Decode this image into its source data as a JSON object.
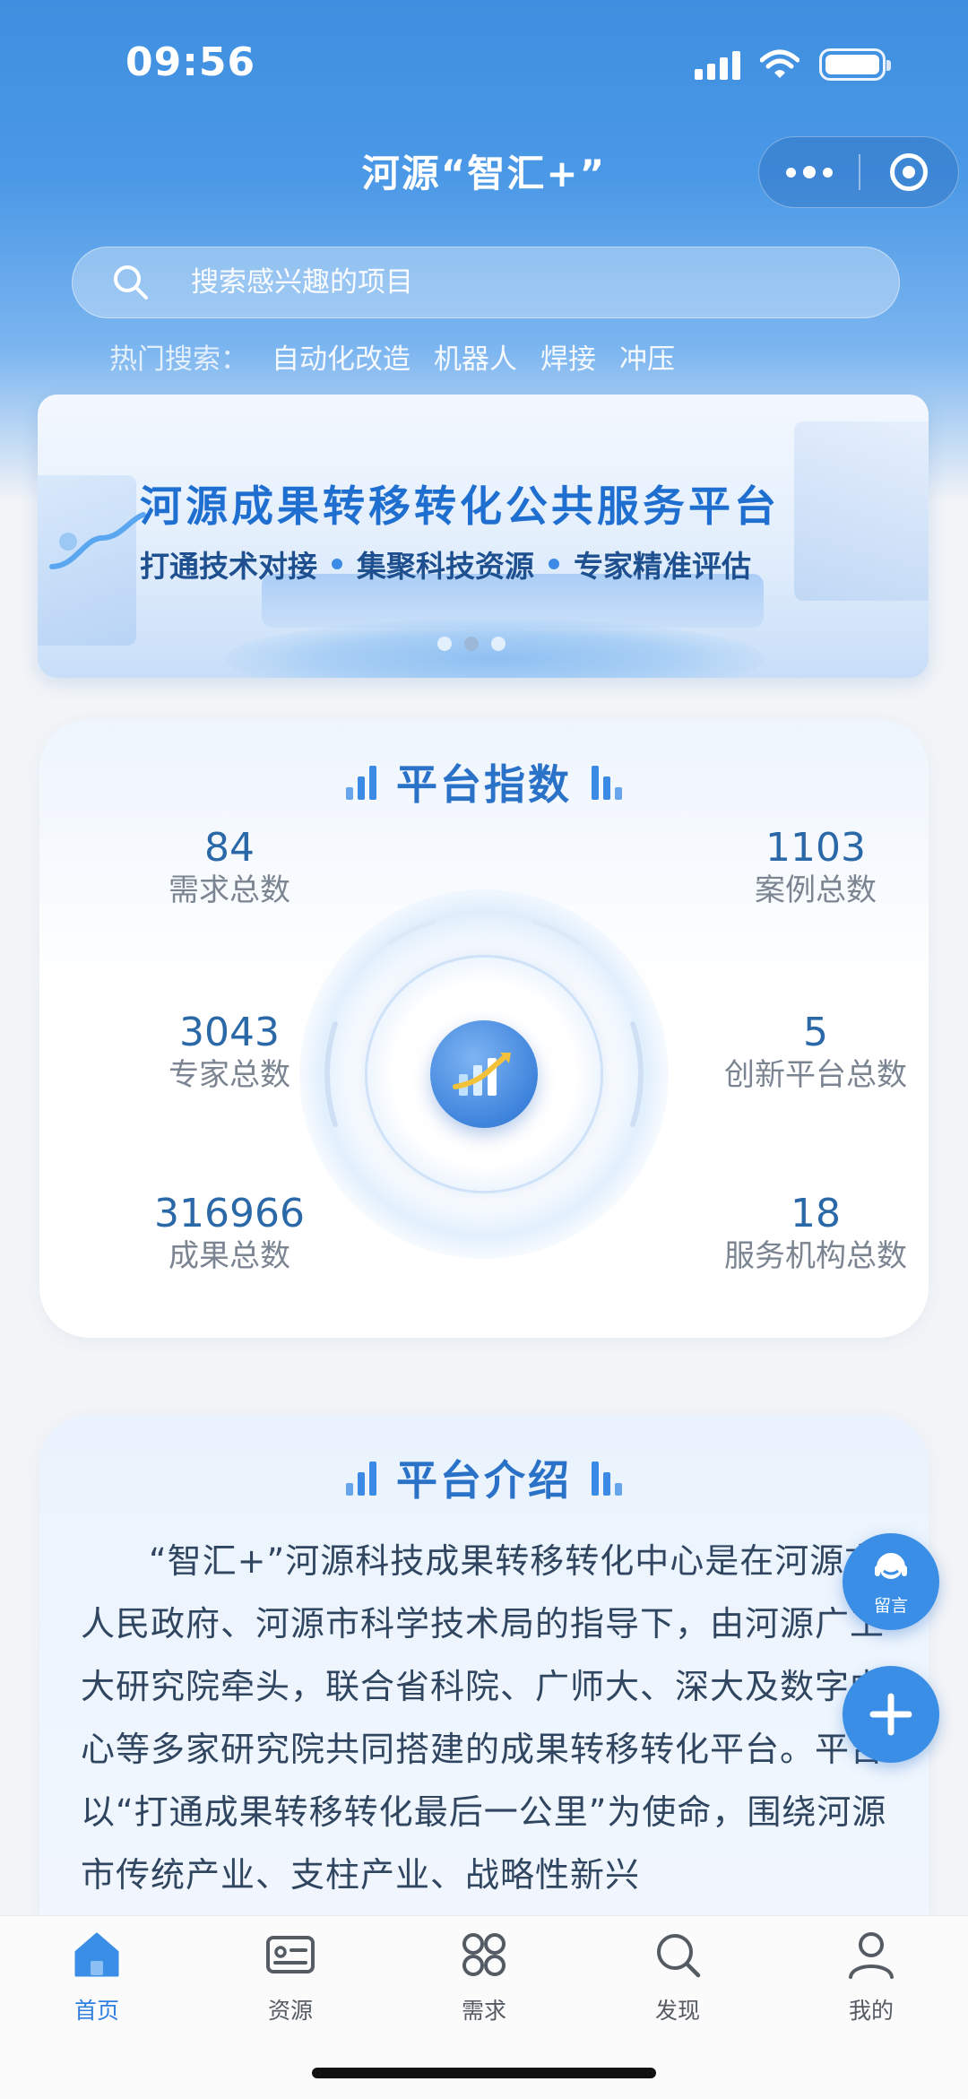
{
  "status_bar": {
    "time": "09:56"
  },
  "nav": {
    "title": "河源“智汇+”"
  },
  "search": {
    "placeholder": "搜索感兴趣的项目"
  },
  "hot_search": {
    "label": "热门搜索：",
    "tags": [
      "自动化改造",
      "机器人",
      "焊接",
      "冲压"
    ]
  },
  "banner": {
    "title": "河源成果转移转化公共服务平台",
    "subtitle_items": [
      "打通技术对接",
      "集聚科技资源",
      "专家精准评估"
    ],
    "page_count": 3,
    "active_page": 2
  },
  "platform_index": {
    "title": "平台指数",
    "stats": [
      {
        "value": "84",
        "label": "需求总数"
      },
      {
        "value": "1103",
        "label": "案例总数"
      },
      {
        "value": "3043",
        "label": "专家总数"
      },
      {
        "value": "5",
        "label": "创新平台总数"
      },
      {
        "value": "316966",
        "label": "成果总数"
      },
      {
        "value": "18",
        "label": "服务机构总数"
      }
    ]
  },
  "platform_intro": {
    "title": "平台介绍",
    "text": "“智汇+”河源科技成果转移转化中心是在河源市人民政府、河源市科学技术局的指导下，由河源广工大研究院牵头，联合省科院、广师大、深大及数字中心等多家研究院共同搭建的成果转移转化平台。平台以“打通成果转移转化最后一公里”为使命，围绕河源市传统产业、支柱产业、战略性新兴"
  },
  "fab": {
    "message_label": "留言"
  },
  "tabbar": {
    "items": [
      {
        "label": "首页",
        "icon": "home-icon",
        "active": true
      },
      {
        "label": "资源",
        "icon": "id-card-icon",
        "active": false
      },
      {
        "label": "需求",
        "icon": "grid-icon",
        "active": false
      },
      {
        "label": "发现",
        "icon": "search-icon",
        "active": false
      },
      {
        "label": "我的",
        "icon": "user-icon",
        "active": false
      }
    ]
  },
  "colors": {
    "primary": "#3a8ee6",
    "header": "#4a98e6",
    "stat_value": "#2a68a8",
    "stat_label": "#7b8491",
    "tab_active": "#2f7fe0"
  }
}
